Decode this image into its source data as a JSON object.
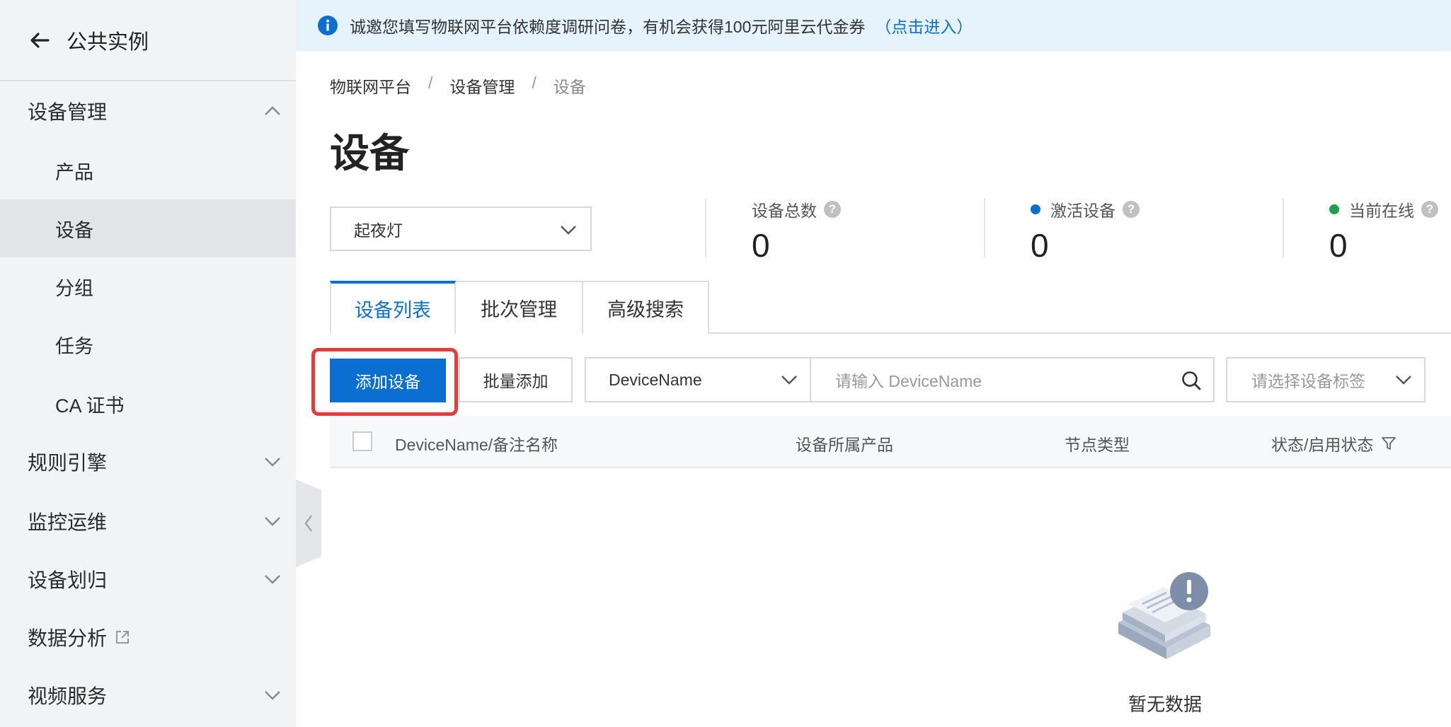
{
  "sidebar": {
    "header_title": "公共实例",
    "groups": [
      {
        "label": "设备管理",
        "expanded": true,
        "items": [
          {
            "label": "产品",
            "active": false
          },
          {
            "label": "设备",
            "active": true
          },
          {
            "label": "分组",
            "active": false
          },
          {
            "label": "任务",
            "active": false
          },
          {
            "label": "CA 证书",
            "active": false
          }
        ]
      },
      {
        "label": "规则引擎"
      },
      {
        "label": "监控运维"
      },
      {
        "label": "设备划归"
      },
      {
        "label": "数据分析"
      },
      {
        "label": "视频服务"
      }
    ]
  },
  "notice": {
    "text": "诚邀您填写物联网平台依赖度调研问卷，有机会获得100元阿里云代金券",
    "link": "（点击进入）"
  },
  "breadcrumb": [
    "物联网平台",
    "设备管理",
    "设备"
  ],
  "page_title": "设备",
  "product_select": {
    "value": "起夜灯"
  },
  "stats": [
    {
      "label": "设备总数",
      "value": "0"
    },
    {
      "label": "激活设备",
      "value": "0",
      "dot_color": "#0a6fd1"
    },
    {
      "label": "当前在线",
      "value": "0",
      "dot_color": "#1e9e52"
    }
  ],
  "tabs": [
    "设备列表",
    "批次管理",
    "高级搜索"
  ],
  "toolbar": {
    "add_device": "添加设备",
    "batch_add": "批量添加",
    "filter_field": "DeviceName",
    "search_placeholder": "请输入 DeviceName",
    "tag_placeholder": "请选择设备标签"
  },
  "table": {
    "columns": [
      "DeviceName/备注名称",
      "设备所属产品",
      "节点类型",
      "状态/启用状态"
    ],
    "empty_text": "暂无数据"
  },
  "colors": {
    "accent": "#0a6fd1",
    "highlight": "#e23c3c",
    "online": "#1e9e52"
  }
}
